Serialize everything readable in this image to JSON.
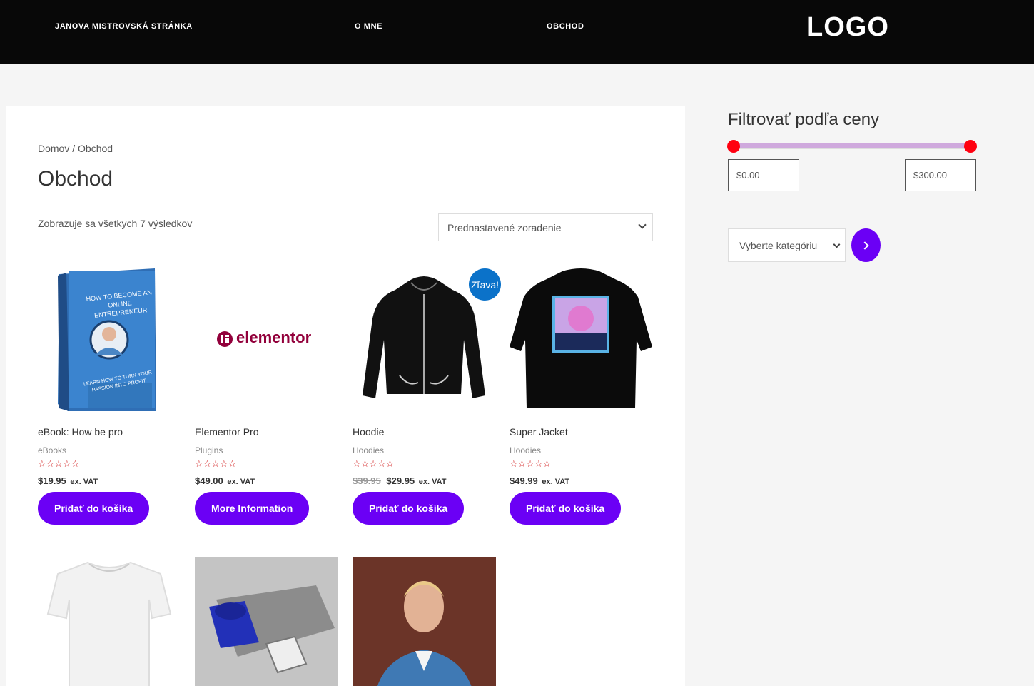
{
  "header": {
    "site_title": "JANOVA MISTROVSKÁ STRÁNKA",
    "nav": [
      "O MNE",
      "OBCHOD"
    ],
    "logo": "LOGO"
  },
  "shop": {
    "breadcrumb": "Domov / Obchod",
    "title": "Obchod",
    "result_count": "Zobrazuje sa všetkych 7 výsledkov",
    "ordering": "Prednastavené zoradenie",
    "stars": "☆☆☆☆☆",
    "vat": "ex. VAT",
    "sale_badge": "Zľava!",
    "products": [
      {
        "name": "eBook: How be pro",
        "category": "eBooks",
        "price": "$19.95",
        "button": "Pridať do košíka"
      },
      {
        "name": "Elementor Pro",
        "category": "Plugins",
        "price": "$49.00",
        "button": "More Information"
      },
      {
        "name": "Hoodie",
        "category": "Hoodies",
        "old_price": "$39.95",
        "price": "$29.95",
        "button": "Pridať do košíka"
      },
      {
        "name": "Super Jacket",
        "category": "Hoodies",
        "price": "$49.99",
        "button": "Pridať do košíka"
      }
    ],
    "ebook_cover": {
      "title": "HOW TO BECOME AN ONLINE ENTREPRENEUR",
      "subtitle": "LEARN HOW TO TURN YOUR PASSION INTO PROFIT"
    },
    "elementor_logo_text": "elementor"
  },
  "sidebar": {
    "filter_title": "Filtrovať podľa ceny",
    "min_price": "$0.00",
    "max_price": "$300.00",
    "category_select": "Vyberte kategóriu"
  },
  "colors": {
    "accent": "#6b00f5",
    "sale_badge": "#0b72c9",
    "star": "#d42a2a",
    "slider_handle": "#ff0010",
    "slider_track": "#cfa9dd"
  }
}
